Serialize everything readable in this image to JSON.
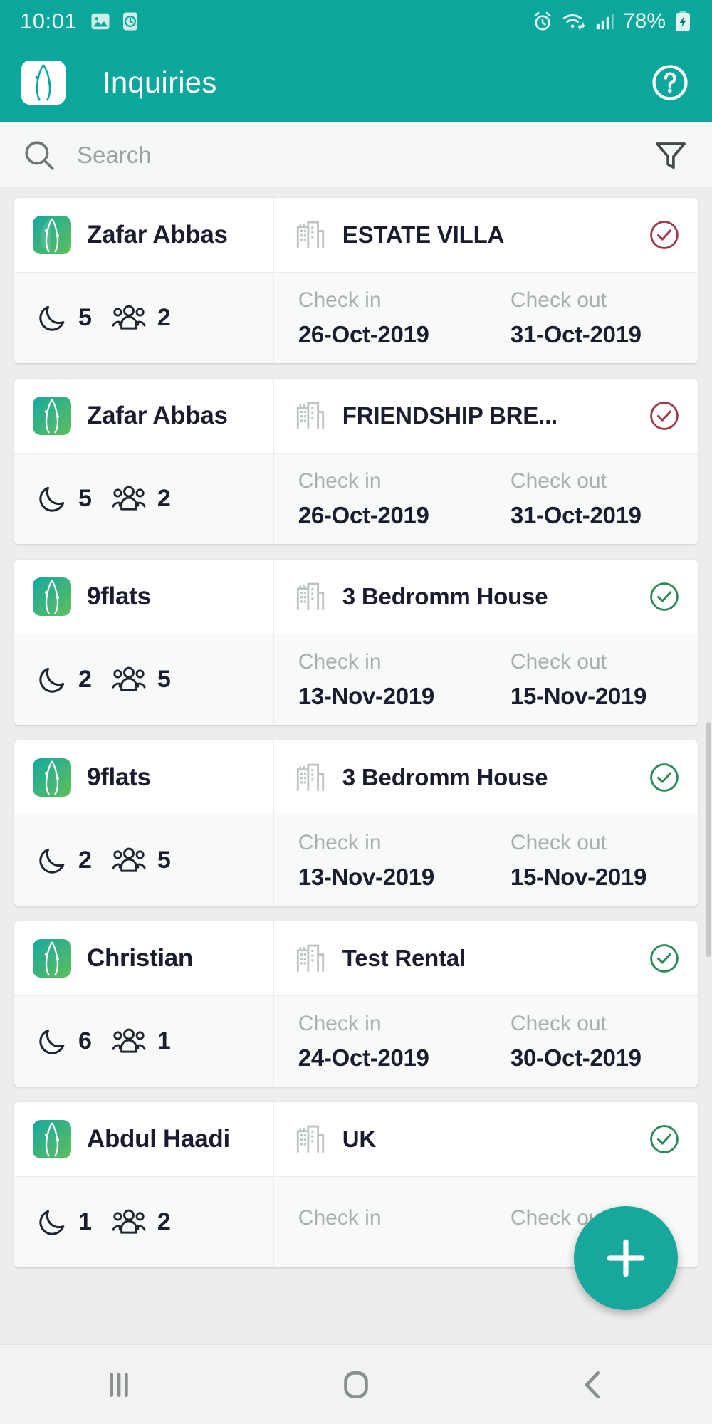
{
  "statusbar": {
    "time": "10:01",
    "battery_text": "78%",
    "left_icons": [
      "image-icon",
      "clock-icon"
    ],
    "right_icons": [
      "alarm-icon",
      "wifi-icon",
      "signal-icon",
      "battery-charging-icon"
    ]
  },
  "appbar": {
    "title": "Inquiries",
    "logo_icon": "app-leaf-logo",
    "help_icon": "help-circle-icon",
    "background_color": "#0BA79C"
  },
  "search": {
    "placeholder": "Search",
    "value": "",
    "search_icon": "search-icon",
    "filter_icon": "filter-funnel-icon"
  },
  "labels": {
    "check_in": "Check in",
    "check_out": "Check out",
    "nights_icon": "moon-icon",
    "guests_icon": "people-group-icon",
    "property_icon": "building-icon"
  },
  "colors": {
    "accent": "#0BA79C",
    "fab": "#17A79C",
    "status_confirmed": "#2E8B57",
    "status_pending": "#A13B4E",
    "card_background": "#FFFFFF",
    "page_background": "#EDEDED"
  },
  "fab": {
    "icon": "plus-icon",
    "label": "+"
  },
  "navbar": {
    "recents_icon": "recents-icon",
    "home_icon": "home-icon",
    "back_icon": "back-icon"
  },
  "inquiries": [
    {
      "guest": "Zafar Abbas",
      "property": "ESTATE VILLA",
      "status": "pending",
      "status_color": "#A13B4E",
      "nights": "5",
      "guests": "2",
      "check_in": "26-Oct-2019",
      "check_out": "31-Oct-2019"
    },
    {
      "guest": "Zafar Abbas",
      "property": "FRIENDSHIP BRE...",
      "status": "pending",
      "status_color": "#A13B4E",
      "nights": "5",
      "guests": "2",
      "check_in": "26-Oct-2019",
      "check_out": "31-Oct-2019"
    },
    {
      "guest": "9flats",
      "property": "3 Bedromm House",
      "status": "confirmed",
      "status_color": "#2E8B57",
      "nights": "2",
      "guests": "5",
      "check_in": "13-Nov-2019",
      "check_out": "15-Nov-2019"
    },
    {
      "guest": "9flats",
      "property": "3 Bedromm House",
      "status": "confirmed",
      "status_color": "#2E8B57",
      "nights": "2",
      "guests": "5",
      "check_in": "13-Nov-2019",
      "check_out": "15-Nov-2019"
    },
    {
      "guest": "Christian",
      "property": "Test Rental",
      "status": "confirmed",
      "status_color": "#2E8B57",
      "nights": "6",
      "guests": "1",
      "check_in": "24-Oct-2019",
      "check_out": "30-Oct-2019"
    },
    {
      "guest": "Abdul Haadi",
      "property": "UK",
      "status": "confirmed",
      "status_color": "#2E8B57",
      "nights": "1",
      "guests": "2",
      "check_in": "",
      "check_out": ""
    }
  ]
}
